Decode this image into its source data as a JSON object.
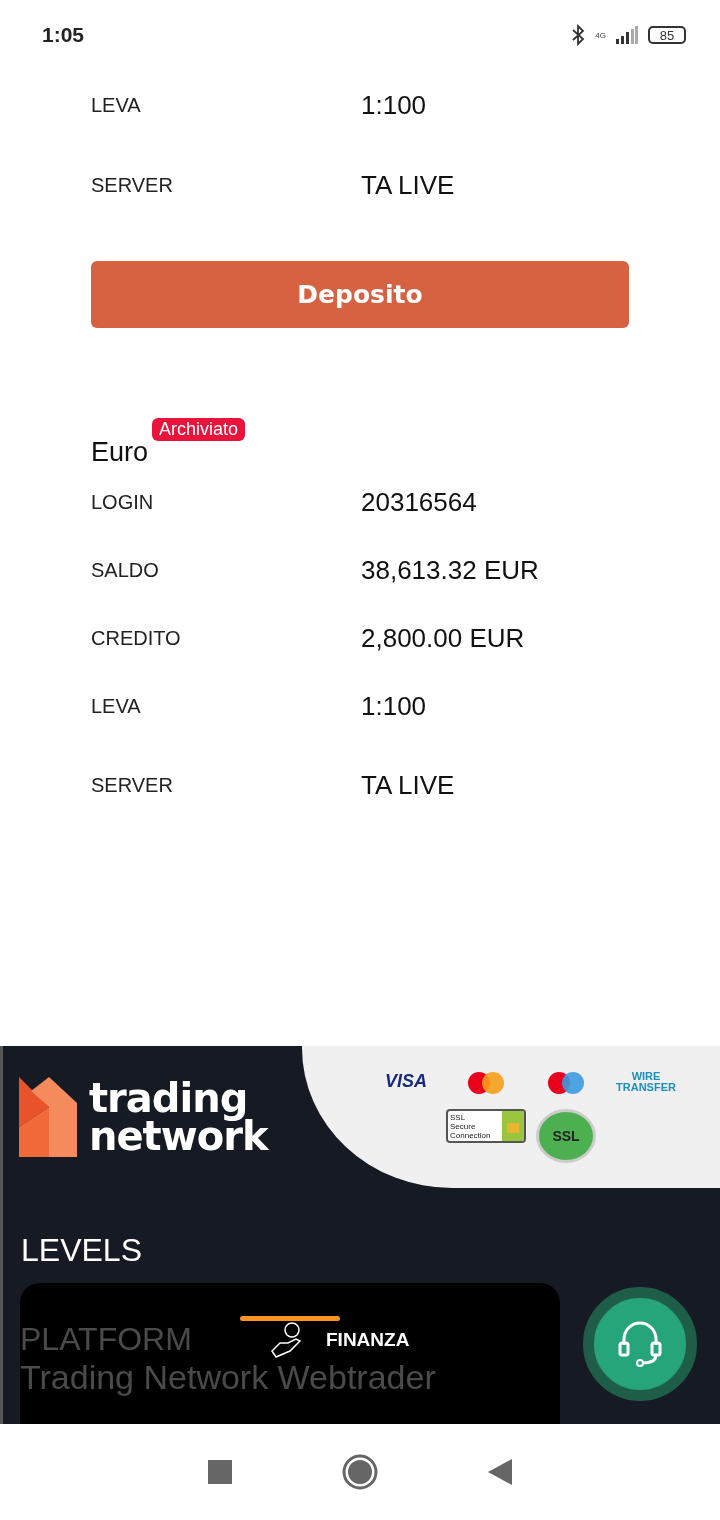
{
  "status_bar": {
    "time": "1:05",
    "network": "4G",
    "battery": "85"
  },
  "account_top": {
    "rows": [
      {
        "label": "LEVA",
        "value": "1:100"
      },
      {
        "label": "SERVER",
        "value": "TA LIVE"
      }
    ],
    "button": "Deposito"
  },
  "account": {
    "currency": "Euro",
    "badge": "Archiviato",
    "rows": [
      {
        "label": "LOGIN",
        "value": "20316564"
      },
      {
        "label": "SALDO",
        "value": "38,613.32 EUR"
      },
      {
        "label": "CREDITO",
        "value": "2,800.00 EUR"
      },
      {
        "label": "LEVA",
        "value": "1:100"
      },
      {
        "label": "SERVER",
        "value": "TA LIVE"
      }
    ]
  },
  "footer": {
    "logo": [
      "trading",
      "network"
    ],
    "payments": {
      "visa": "VISA",
      "wire": [
        "WIRE",
        "TRANSFER"
      ],
      "ssl": [
        "SSL",
        "Secure",
        "Connection"
      ],
      "seal": "SSL"
    },
    "heading": "LEVELS",
    "card": {
      "title": "PLATFORM",
      "subtitle": "Trading Network Webtrader"
    },
    "sheet": {
      "label": "FINANZA"
    }
  }
}
